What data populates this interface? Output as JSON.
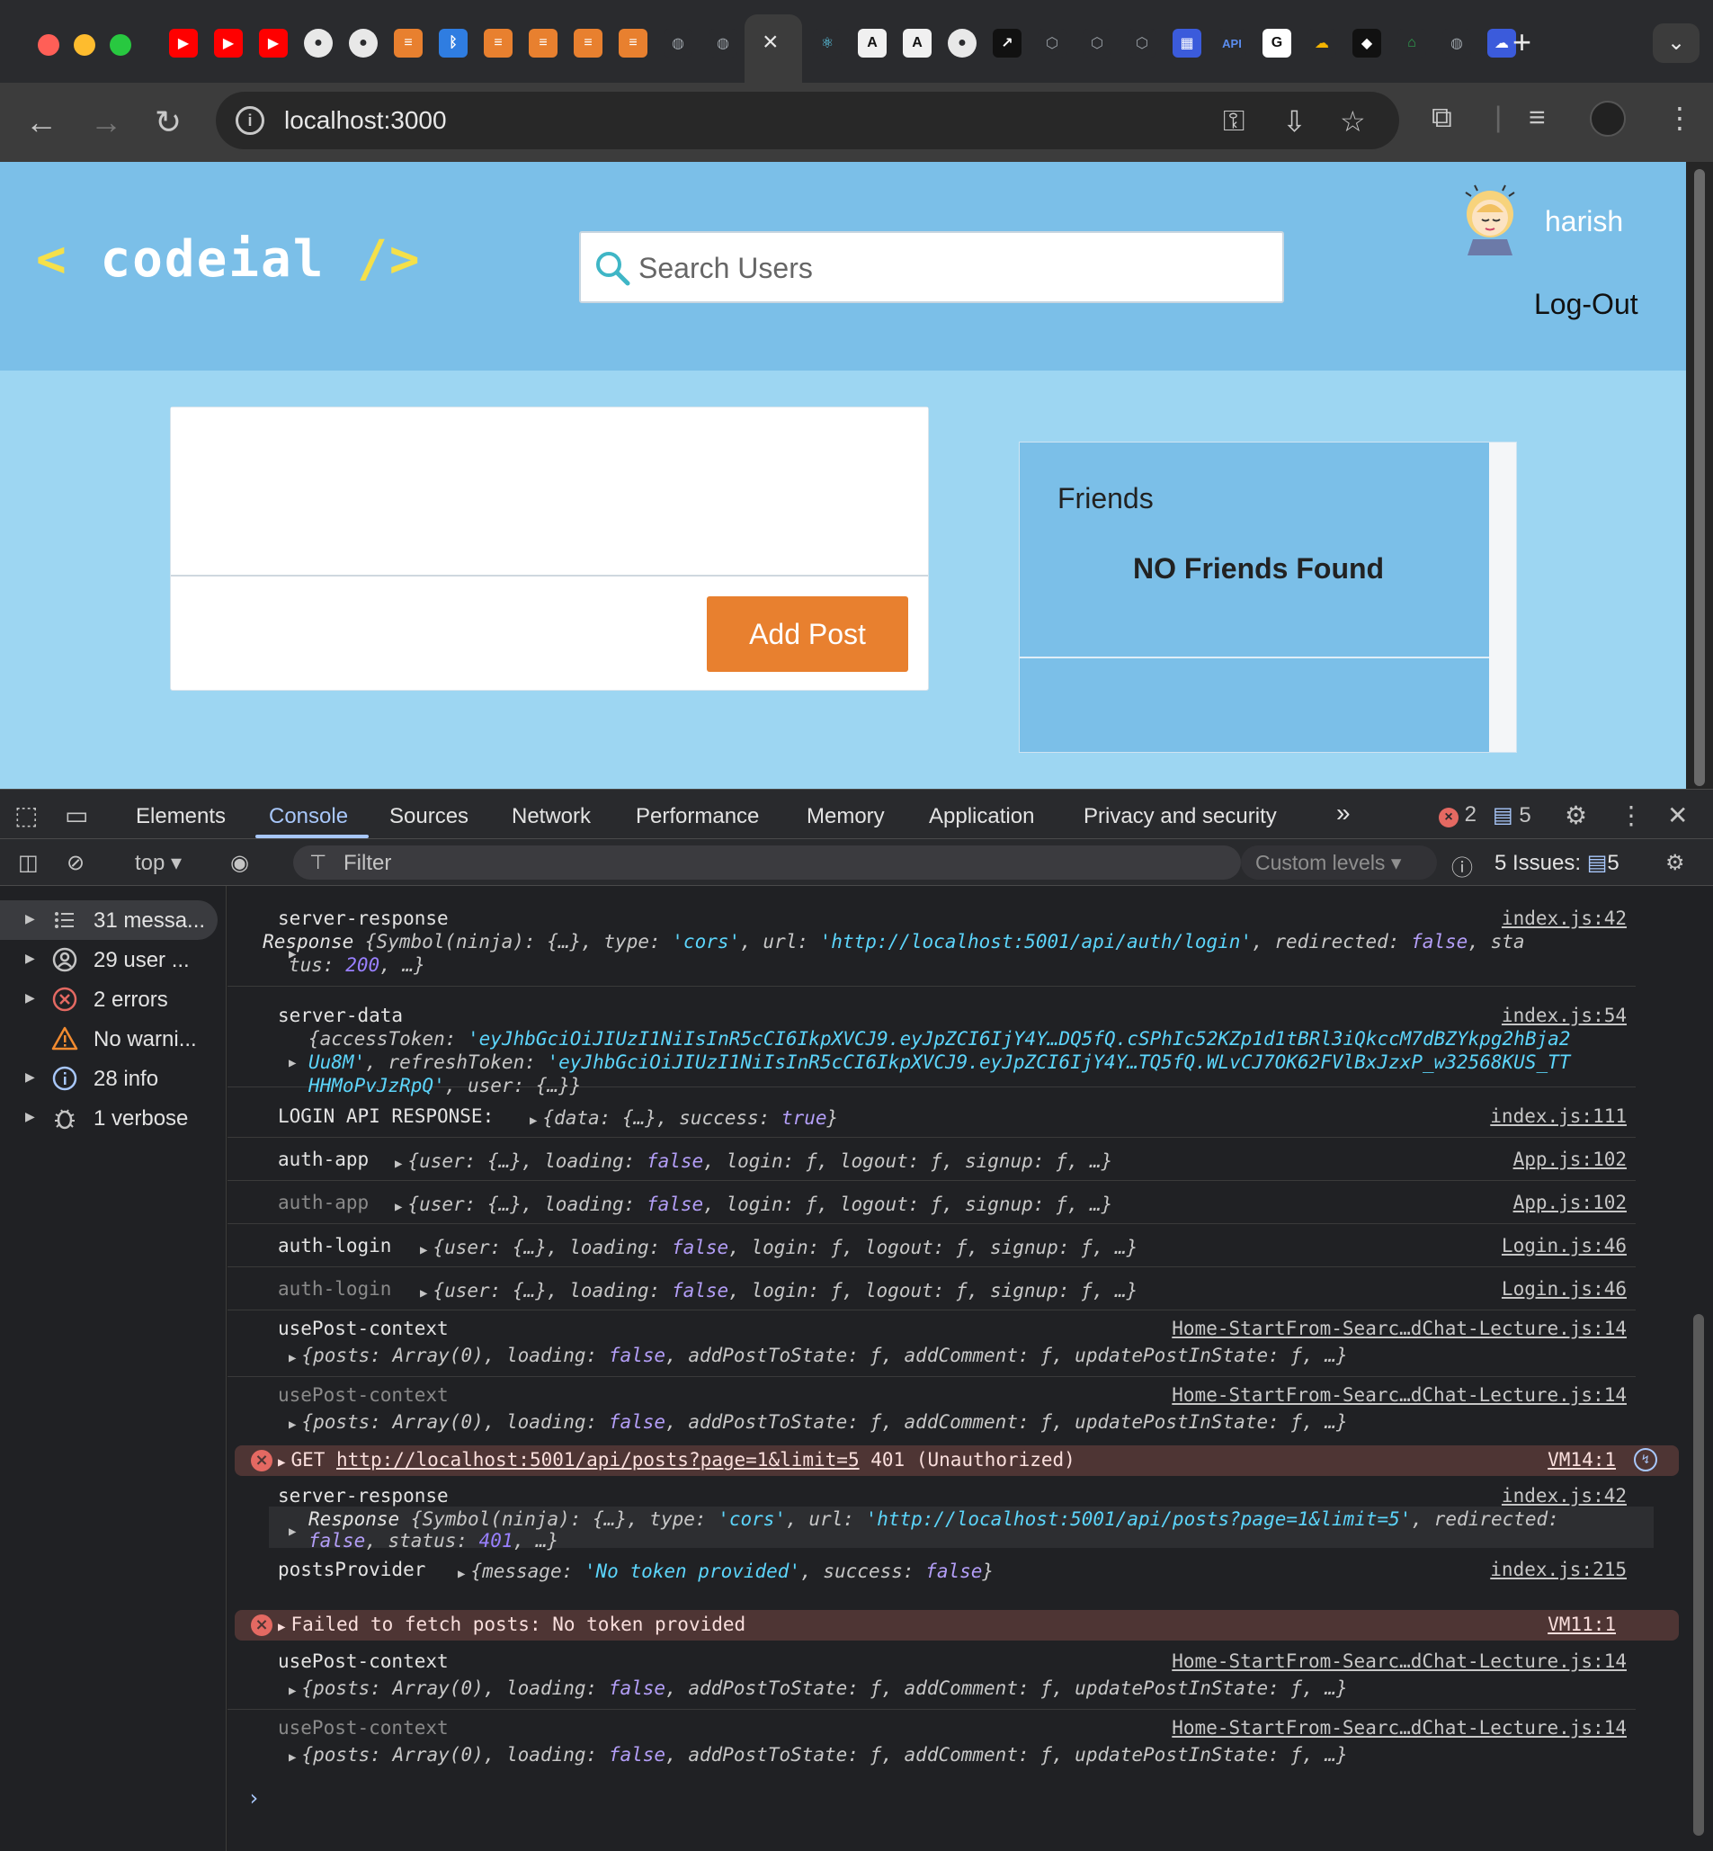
{
  "browser": {
    "url": "localhost:3000",
    "active_tab_close": "×",
    "new_tab": "+",
    "tab_icons": [
      "youtube-icon",
      "youtube-icon",
      "youtube-icon",
      "github-icon",
      "github-icon",
      "codeial-icon",
      "bluetooth-icon",
      "codeial-icon",
      "codeial-icon",
      "codeial-icon",
      "codeial-icon",
      "globe-icon",
      "globe-icon",
      "react-icon",
      "anthropic-icon",
      "anthropic-icon",
      "github-icon",
      "terminal-icon",
      "chatgpt-icon",
      "chatgpt-icon",
      "chatgpt-icon",
      "chip-icon",
      "api-icon",
      "google-icon",
      "cloud-icon",
      "box-icon",
      "home-icon",
      "globe-icon",
      "cloud-dashboard-icon"
    ],
    "colors": {
      "tabbar": "#2a2b2e",
      "toolbar": "#3c3c3c"
    }
  },
  "app": {
    "logo_left": "<",
    "logo_text": "codeial",
    "logo_right": "/>",
    "search_placeholder": "Search Users",
    "username": "harish",
    "logout": "Log-Out",
    "add_post": "Add Post",
    "friends_title": "Friends",
    "friends_empty": "NO Friends Found",
    "colors": {
      "header": "#7bbfe8",
      "page": "#9dd6f2",
      "button": "#e8802f",
      "logo_accent": "#f5e04a"
    }
  },
  "devtools": {
    "tabs": [
      "Elements",
      "Console",
      "Sources",
      "Network",
      "Performance",
      "Memory",
      "Application",
      "Privacy and security"
    ],
    "active_tab": "Console",
    "more": "»",
    "error_count": "2",
    "issue_count": "5",
    "context": "top",
    "filter_placeholder": "Filter",
    "levels": "Custom levels",
    "issues_label": "5 Issues:",
    "issues_count": "5",
    "sidebar": [
      {
        "label": "31 messa...",
        "icon": "list-icon"
      },
      {
        "label": "29 user ...",
        "icon": "user-icon"
      },
      {
        "label": "2 errors",
        "icon": "error-icon"
      },
      {
        "label": "No warni...",
        "icon": "warning-icon"
      },
      {
        "label": "28 info",
        "icon": "info-icon"
      },
      {
        "label": "1 verbose",
        "icon": "bug-icon"
      }
    ],
    "console": {
      "r1_label": "server-response",
      "r1_src": "index.js:42",
      "r1_line1a": "Response",
      "r1_line1b": "{Symbol(ninja): {…}, type: ",
      "r1_type": "'cors'",
      "r1_line1c": ", url: ",
      "r1_url": "'http://localhost:5001/api/auth/login'",
      "r1_line1d": ", redirected: ",
      "r1_red": "false",
      "r1_line1e": ", sta",
      "r1_line2a": "tus: ",
      "r1_status": "200",
      "r1_line2b": ", …}",
      "r2_label": "server-data",
      "r2_src": "index.js:54",
      "r2_l1a": "{accessToken: ",
      "r2_l1b": "'eyJhbGciOiJIUzI1NiIsInR5cCI6IkpXVCJ9.eyJpZCI6IjY4Y…DQ5fQ.cSPhIc52KZp1d1tBRl3iQkccM7dBZYkpg2hBja2",
      "r2_l2a": "Uu8M'",
      "r2_l2b": ", refreshToken: ",
      "r2_l2c": "'eyJhbGciOiJIUzI1NiIsInR5cCI6IkpXVCJ9.eyJpZCI6IjY4Y…TQ5fQ.WLvCJ7OK62FVlBxJzxP_w32568KUS_TT",
      "r2_l3a": "HHMoPvJzRpQ'",
      "r2_l3b": ", user: {…}}",
      "r3_label": "LOGIN API RESPONSE:",
      "r3_a": "{data: {…}, success: ",
      "r3_b": "true",
      "r3_c": "}",
      "r3_src": "index.js:111",
      "auth_a": "{user: {…}, loading: ",
      "auth_b": "false",
      "auth_c": ", login: ƒ, logout: ƒ, signup: ƒ, …}",
      "r4_label": "auth-app",
      "r4_src": "App.js:102",
      "r5_label": "auth-app",
      "r5_src": "App.js:102",
      "r6_label": "auth-login",
      "r6_src": "Login.js:46",
      "r7_label": "auth-login",
      "r7_src": "Login.js:46",
      "up_label": "usePost-context",
      "up_src": "Home-StartFrom-Searc…dChat-Lecture.js:14",
      "up_a": "{posts: Array(0), loading: ",
      "up_b": "false",
      "up_c": ", addPostToState: ƒ, addComment: ƒ, updatePostInState: ƒ, …}",
      "e1_a": "GET ",
      "e1_url": "http://localhost:5001/api/posts?page=1&limit=5",
      "e1_b": " 401 (Unauthorized)",
      "e1_src": "VM14:1",
      "r10_label": "server-response",
      "r10_src": "index.js:42",
      "r10_l1a": "Response",
      "r10_l1b": "{Symbol(ninja): {…}, type: ",
      "r10_type": "'cors'",
      "r10_l1c": ", url: ",
      "r10_url": "'http://localhost:5001/api/posts?page=1&limit=5'",
      "r10_l1d": ", redirected:",
      "r10_l2a": "false",
      "r10_l2b": ", status: ",
      "r10_l2c": "401",
      "r10_l2d": ", …}",
      "r11_label": "postsProvider",
      "r11_a": "{message: ",
      "r11_b": "'No token provided'",
      "r11_c": ", success: ",
      "r11_d": "false",
      "r11_e": "}",
      "r11_src": "index.js:215",
      "e2_text": "Failed to fetch posts: No token provided",
      "e2_src": "VM11:1",
      "prompt": "›"
    }
  }
}
